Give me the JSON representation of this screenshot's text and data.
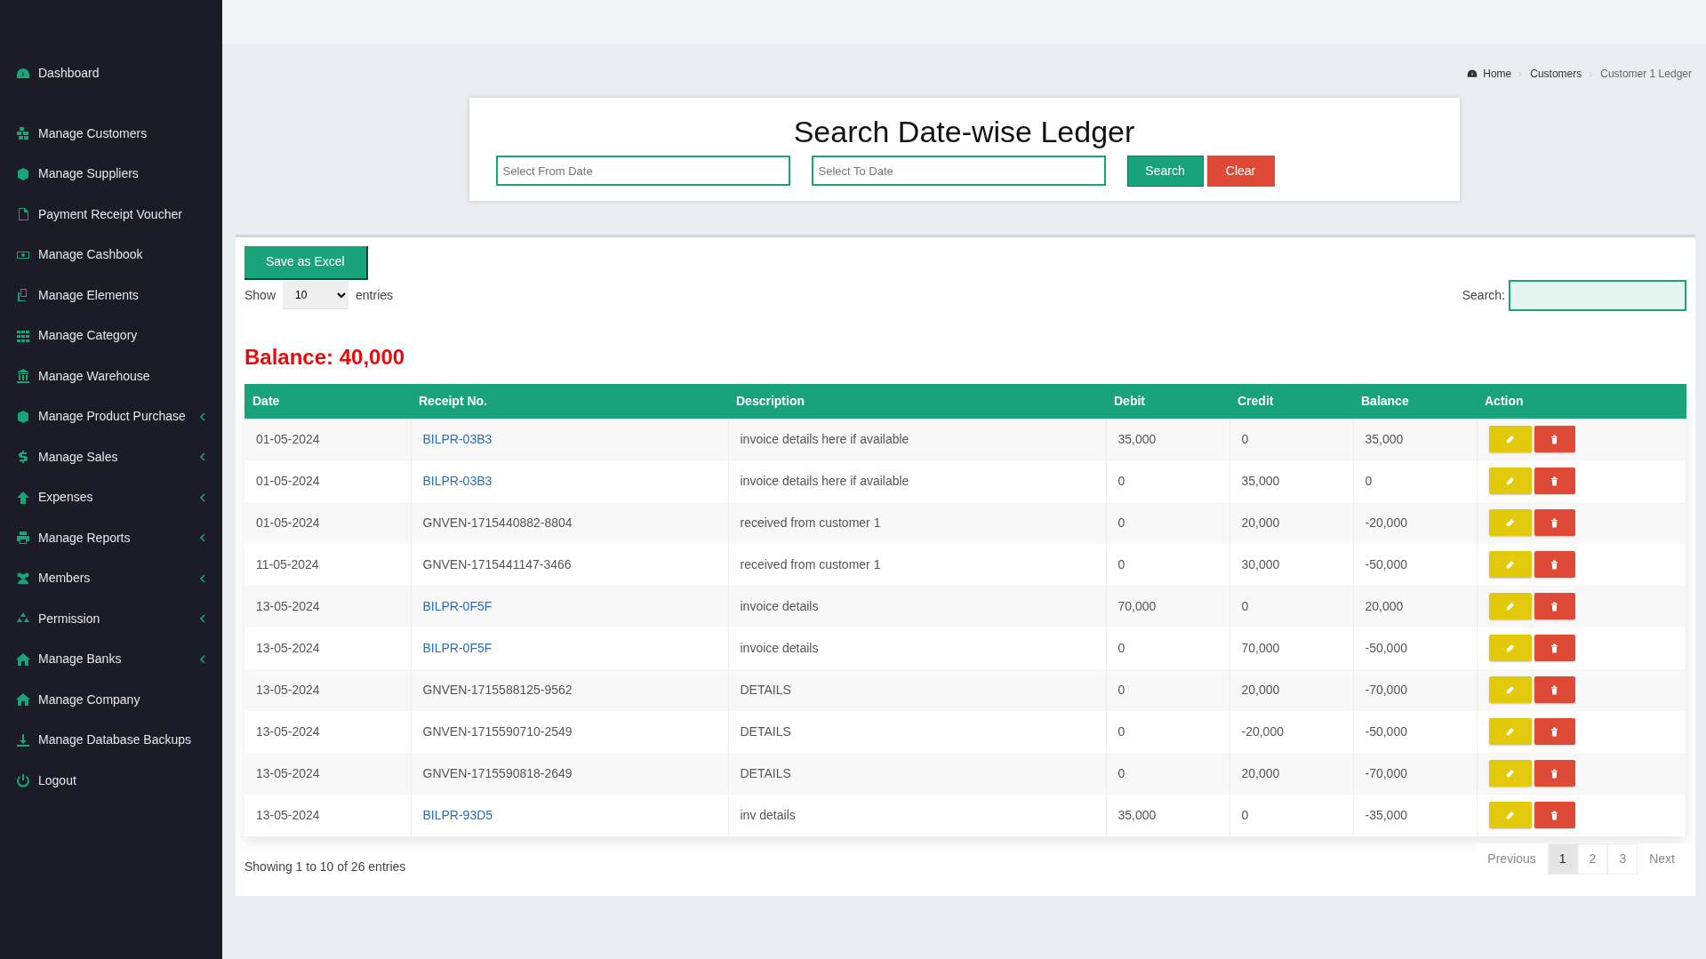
{
  "sidebar": {
    "items": [
      {
        "label": "Dashboard",
        "has_submenu": false
      },
      {
        "label": "Manage Customers",
        "has_submenu": false
      },
      {
        "label": "Manage Suppliers",
        "has_submenu": false
      },
      {
        "label": "Payment Receipt Voucher",
        "has_submenu": false
      },
      {
        "label": "Manage Cashbook",
        "has_submenu": false
      },
      {
        "label": "Manage Elements",
        "has_submenu": false
      },
      {
        "label": "Manage Category",
        "has_submenu": false
      },
      {
        "label": "Manage Warehouse",
        "has_submenu": false
      },
      {
        "label": "Manage Product Purchase",
        "has_submenu": true
      },
      {
        "label": "Manage Sales",
        "has_submenu": true
      },
      {
        "label": "Expenses",
        "has_submenu": true
      },
      {
        "label": "Manage Reports",
        "has_submenu": true
      },
      {
        "label": "Members",
        "has_submenu": true
      },
      {
        "label": "Permission",
        "has_submenu": true
      },
      {
        "label": "Manage Banks",
        "has_submenu": true
      },
      {
        "label": "Manage Company",
        "has_submenu": false
      },
      {
        "label": "Manage Database Backups",
        "has_submenu": false
      },
      {
        "label": "Logout",
        "has_submenu": false
      }
    ]
  },
  "breadcrumb": [
    {
      "label": "Home",
      "link": true
    },
    {
      "label": "Customers",
      "link": true
    },
    {
      "label": "Customer 1 Ledger",
      "link": false
    }
  ],
  "search_panel": {
    "title": "Search Date-wise Ledger",
    "from_placeholder": "Select From Date",
    "to_placeholder": "Select To Date",
    "search_button": "Search",
    "clear_button": "Clear"
  },
  "ledger": {
    "export_button": "Save as Excel",
    "show_label": "Show",
    "page_size": "10",
    "entries_label": "entries",
    "search_label": "Search:",
    "balance": "Balance: 40,000",
    "table": {
      "columns": [
        "Date",
        "Receipt No.",
        "Description",
        "Debit",
        "Credit",
        "Balance",
        "Action"
      ],
      "rows": [
        {
          "date": "01-05-2024",
          "receipt": "BILPR-03B3",
          "receipt_link": true,
          "description": "invoice details here if available",
          "debit": "35,000",
          "credit": "0",
          "balance": "35,000"
        },
        {
          "date": "01-05-2024",
          "receipt": "BILPR-03B3",
          "receipt_link": true,
          "description": "invoice details here if available",
          "debit": "0",
          "credit": "35,000",
          "balance": "0"
        },
        {
          "date": "01-05-2024",
          "receipt": "GNVEN-1715440882-8804",
          "receipt_link": false,
          "description": "received from customer 1",
          "debit": "0",
          "credit": "20,000",
          "balance": "-20,000"
        },
        {
          "date": "11-05-2024",
          "receipt": "GNVEN-1715441147-3466",
          "receipt_link": false,
          "description": "received from customer 1",
          "debit": "0",
          "credit": "30,000",
          "balance": "-50,000"
        },
        {
          "date": "13-05-2024",
          "receipt": "BILPR-0F5F",
          "receipt_link": true,
          "description": "invoice details",
          "debit": "70,000",
          "credit": "0",
          "balance": "20,000"
        },
        {
          "date": "13-05-2024",
          "receipt": "BILPR-0F5F",
          "receipt_link": true,
          "description": "invoice details",
          "debit": "0",
          "credit": "70,000",
          "balance": "-50,000"
        },
        {
          "date": "13-05-2024",
          "receipt": "GNVEN-1715588125-9562",
          "receipt_link": false,
          "description": "DETAILS",
          "debit": "0",
          "credit": "20,000",
          "balance": "-70,000"
        },
        {
          "date": "13-05-2024",
          "receipt": "GNVEN-1715590710-2549",
          "receipt_link": false,
          "description": "DETAILS",
          "debit": "0",
          "credit": "-20,000",
          "balance": "-50,000"
        },
        {
          "date": "13-05-2024",
          "receipt": "GNVEN-1715590818-2649",
          "receipt_link": false,
          "description": "DETAILS",
          "debit": "0",
          "credit": "20,000",
          "balance": "-70,000"
        },
        {
          "date": "13-05-2024",
          "receipt": "BILPR-93D5",
          "receipt_link": true,
          "description": "inv details",
          "debit": "35,000",
          "credit": "0",
          "balance": "-35,000"
        }
      ]
    },
    "info": "Showing 1 to 10 of 26 entries",
    "pagination": [
      {
        "label": "Previous",
        "kind": "nav",
        "selected": false
      },
      {
        "label": "1",
        "kind": "page",
        "selected": true
      },
      {
        "label": "2",
        "kind": "page",
        "selected": false
      },
      {
        "label": "3",
        "kind": "page",
        "selected": false
      },
      {
        "label": "Next",
        "kind": "nav",
        "selected": false
      }
    ]
  }
}
